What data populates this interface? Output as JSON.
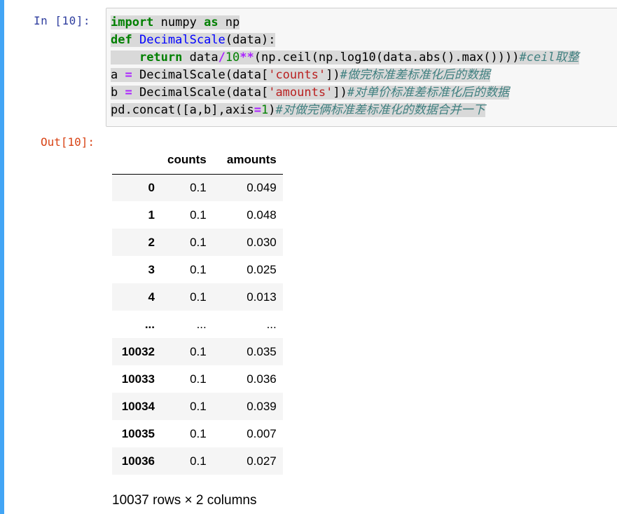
{
  "cell": {
    "in_prompt": "In  [10]:",
    "out_prompt": "Out[10]:",
    "code_lines": [
      [
        {
          "t": "import",
          "c": "kw"
        },
        {
          "t": " numpy "
        },
        {
          "t": "as",
          "c": "kw"
        },
        {
          "t": " np"
        }
      ],
      [
        {
          "t": "def",
          "c": "kw"
        },
        {
          "t": " "
        },
        {
          "t": "DecimalScale",
          "c": "nf"
        },
        {
          "t": "(data):"
        }
      ],
      [
        {
          "t": "    "
        },
        {
          "t": "return",
          "c": "kw"
        },
        {
          "t": " data"
        },
        {
          "t": "/",
          "c": "op"
        },
        {
          "t": "10",
          "c": "num"
        },
        {
          "t": "**",
          "c": "op"
        },
        {
          "t": "(np.ceil(np.log10(data.abs().max())))"
        },
        {
          "t": "#ceil取整",
          "c": "cm"
        }
      ],
      [
        {
          "t": "a "
        },
        {
          "t": "=",
          "c": "op"
        },
        {
          "t": " DecimalScale(data["
        },
        {
          "t": "'counts'",
          "c": "str"
        },
        {
          "t": "])"
        },
        {
          "t": "#做完标准差标准化后的数据",
          "c": "cm"
        }
      ],
      [
        {
          "t": "b "
        },
        {
          "t": "=",
          "c": "op"
        },
        {
          "t": " DecimalScale(data["
        },
        {
          "t": "'amounts'",
          "c": "str"
        },
        {
          "t": "])"
        },
        {
          "t": "#对单价标准差标准化后的数据",
          "c": "cm"
        }
      ],
      [
        {
          "t": "pd.concat([a,b],axis"
        },
        {
          "t": "=",
          "c": "op"
        },
        {
          "t": "1",
          "c": "num"
        },
        {
          "t": ")"
        },
        {
          "t": "#对做完俩标准差标准化的数据合并一下",
          "c": "cm"
        }
      ]
    ]
  },
  "output": {
    "columns": [
      "",
      "counts",
      "amounts"
    ],
    "rows": [
      [
        "0",
        "0.1",
        "0.049"
      ],
      [
        "1",
        "0.1",
        "0.048"
      ],
      [
        "2",
        "0.1",
        "0.030"
      ],
      [
        "3",
        "0.1",
        "0.025"
      ],
      [
        "4",
        "0.1",
        "0.013"
      ],
      [
        "...",
        "...",
        "..."
      ],
      [
        "10032",
        "0.1",
        "0.035"
      ],
      [
        "10033",
        "0.1",
        "0.036"
      ],
      [
        "10034",
        "0.1",
        "0.039"
      ],
      [
        "10035",
        "0.1",
        "0.007"
      ],
      [
        "10036",
        "0.1",
        "0.027"
      ]
    ],
    "summary": "10037 rows × 2 columns"
  }
}
